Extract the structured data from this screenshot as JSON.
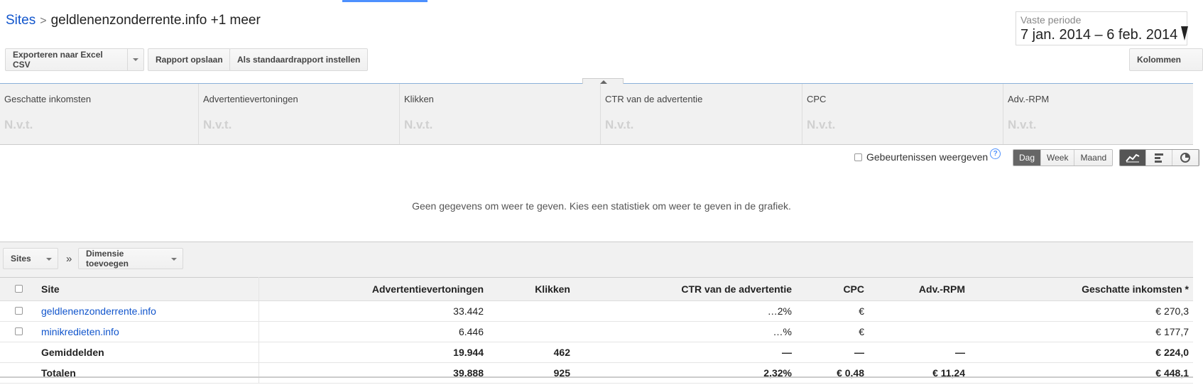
{
  "breadcrumb": {
    "root": "Sites",
    "separator": ">",
    "current": "geldlenenzonderrente.info +1 meer"
  },
  "date": {
    "label": "Vaste periode",
    "range": "7 jan. 2014 – 6 feb. 2014"
  },
  "toolbar": {
    "export_label": "Exporteren naar Excel CSV",
    "save_label": "Rapport opslaan",
    "default_label": "Als standaardrapport instellen",
    "columns_label": "Kolommen"
  },
  "metrics": [
    {
      "label": "Geschatte inkomsten",
      "value": "N.v.t."
    },
    {
      "label": "Advertentievertoningen",
      "value": "N.v.t."
    },
    {
      "label": "Klikken",
      "value": "N.v.t."
    },
    {
      "label": "CTR van de advertentie",
      "value": "N.v.t."
    },
    {
      "label": "CPC",
      "value": "N.v.t."
    },
    {
      "label": "Adv.-RPM",
      "value": "N.v.t."
    }
  ],
  "graph": {
    "events_label": "Gebeurtenissen weergeven",
    "periods": [
      "Dag",
      "Week",
      "Maand"
    ],
    "active_period": "Dag",
    "no_data": "Geen gegevens om weer te geven. Kies een statistiek om weer te geven in de grafiek."
  },
  "dimension": {
    "selected": "Sites",
    "separator": "»",
    "add_label": "Dimensie toevoegen"
  },
  "table": {
    "headers": [
      "Site",
      "Advertentievertoningen",
      "Klikken",
      "CTR van de advertentie",
      "CPC",
      "Adv.-RPM",
      "Geschatte inkomsten *"
    ],
    "rows": [
      [
        "geldlenenzonderrente.info",
        "33.442",
        "",
        "…2%",
        "€",
        "",
        "€ 270,3"
      ],
      [
        "minikredieten.info",
        "6.446",
        "",
        "…%",
        "€",
        "",
        "€ 177,7"
      ]
    ],
    "averages": [
      "Gemiddelden",
      "19.944",
      "462",
      "—",
      "—",
      "—",
      "€ 224,0"
    ],
    "totals": [
      "Totalen",
      "39.888",
      "925",
      "2,32%",
      "€ 0,48",
      "€ 11,24",
      "€ 448,1"
    ]
  },
  "colors": {
    "link": "#1155cc",
    "accent": "#4d90fe"
  }
}
